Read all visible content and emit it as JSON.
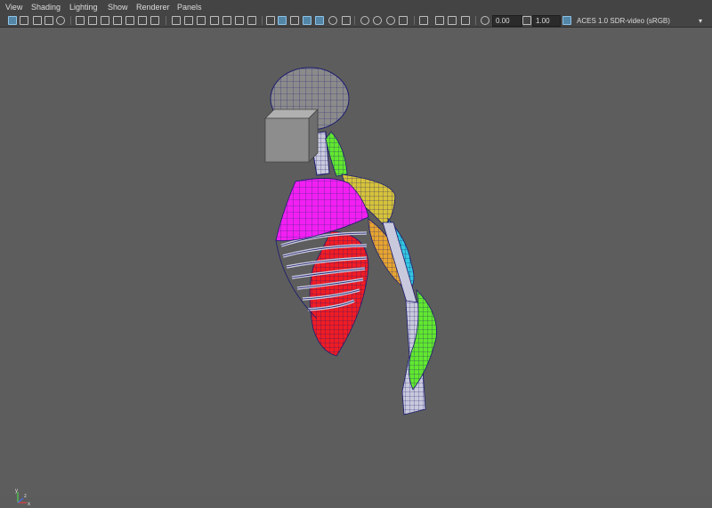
{
  "menu": [
    "View",
    "Shading",
    "Lighting",
    "Show",
    "Renderer",
    "Panels"
  ],
  "toolbar": {
    "exposure_value": "0.00",
    "gamma_value": "1.00",
    "color_space": "ACES 1.0 SDR-video (sRGB)",
    "dropdown_arrow": "▾"
  },
  "colors": {
    "background": "#5d5d5d",
    "menubar": "#444444",
    "head": "#8b8b8b",
    "magenta_muscle": "#f21ff2",
    "red_muscle": "#f01c24",
    "green_muscle": "#62e82f",
    "orange_muscle": "#e6a531",
    "yellow_muscle": "#d6c33a",
    "cyan_muscle": "#34c7e0",
    "bone": "#c9c9dd",
    "wire": "#1c1c6e"
  },
  "viewport": {
    "axis_labels": {
      "x": "x",
      "y": "y",
      "z": "z"
    }
  }
}
